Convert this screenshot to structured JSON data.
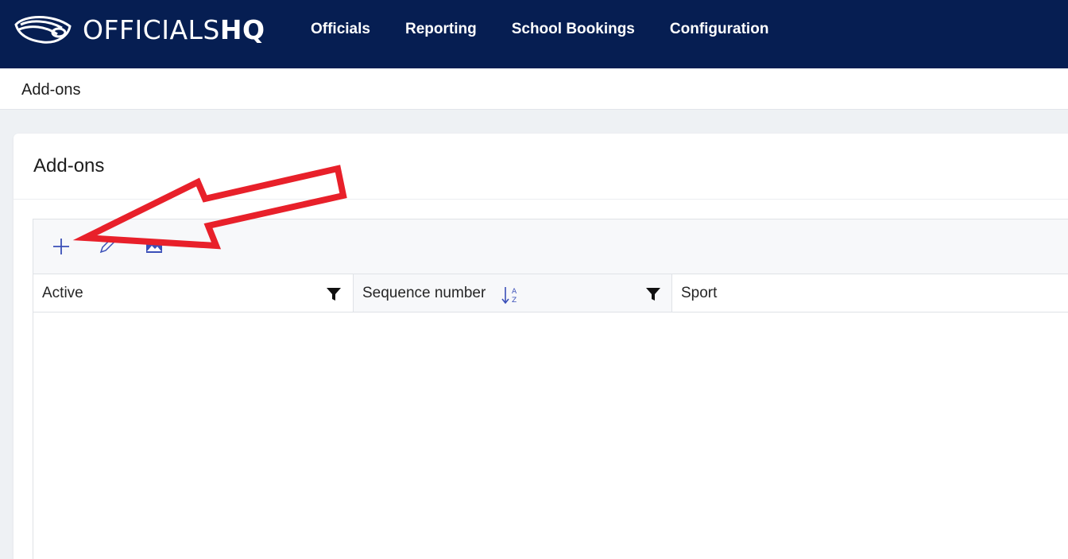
{
  "app": {
    "logo_text_light": "OFFICIALS",
    "logo_text_bold": "HQ",
    "nav_bg": "#061e52"
  },
  "nav": {
    "items": [
      {
        "label": "Officials"
      },
      {
        "label": "Reporting"
      },
      {
        "label": "School Bookings"
      },
      {
        "label": "Configuration"
      }
    ]
  },
  "breadcrumb": {
    "label": "Add-ons"
  },
  "card": {
    "title": "Add-ons"
  },
  "toolbar": {
    "buttons": [
      {
        "icon": "plus-icon",
        "action": "add"
      },
      {
        "icon": "pencil-icon",
        "action": "edit"
      },
      {
        "icon": "image-icon",
        "action": "image"
      }
    ],
    "accent": "#3a4fb8"
  },
  "grid": {
    "columns": [
      {
        "label": "Active",
        "filter": true,
        "sort": false
      },
      {
        "label": "Sequence number",
        "filter": true,
        "sort": true
      },
      {
        "label": "Sport",
        "filter": false,
        "sort": false
      }
    ],
    "rows": []
  },
  "annotation": {
    "type": "red arrow pointing to add button",
    "color": "#e8202a"
  }
}
